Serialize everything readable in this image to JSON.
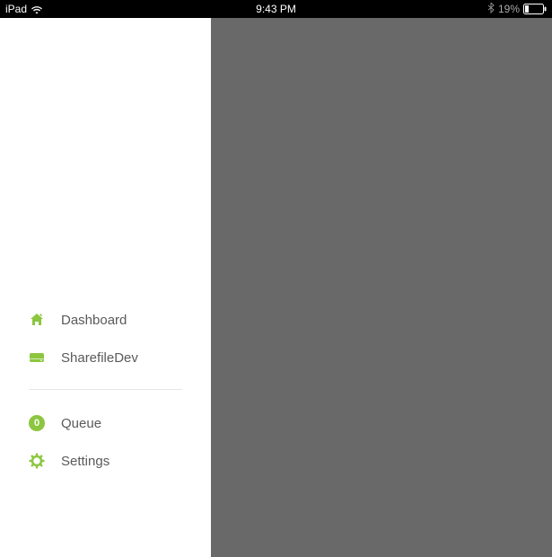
{
  "status": {
    "device": "iPad",
    "time": "9:43 PM",
    "battery_percent": "19%"
  },
  "sidebar": {
    "items": [
      {
        "label": "Dashboard",
        "icon": "home-icon"
      },
      {
        "label": "SharefileDev",
        "icon": "disk-icon"
      },
      {
        "label": "Queue",
        "icon": "badge",
        "badge": "0"
      },
      {
        "label": "Settings",
        "icon": "gear-icon"
      }
    ]
  }
}
